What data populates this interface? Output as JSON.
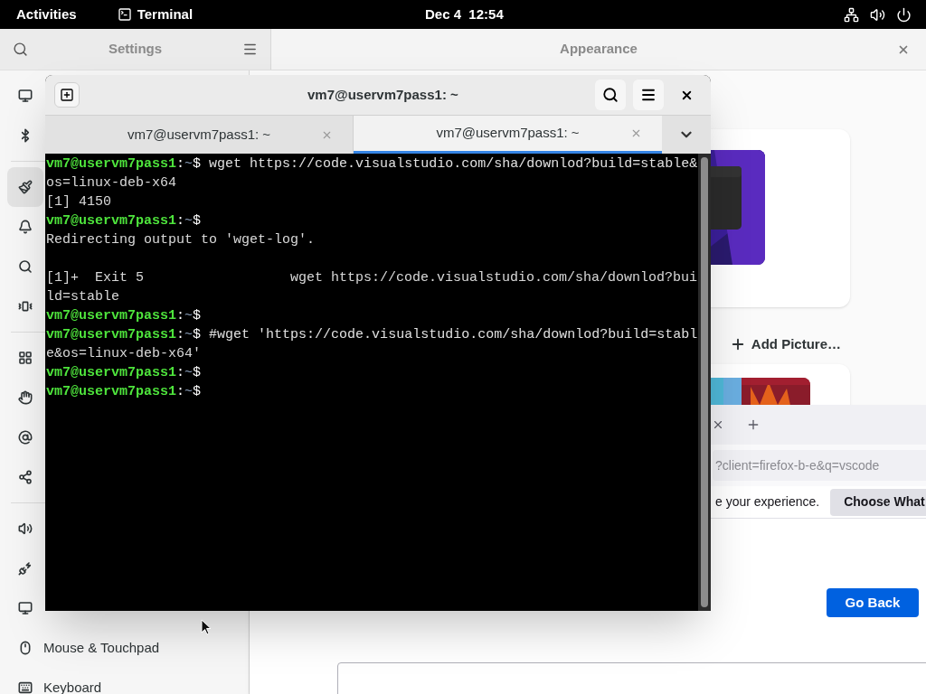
{
  "top_bar": {
    "activities": "Activities",
    "app": "Terminal",
    "clock": "Dec 4  12:54"
  },
  "settings": {
    "title": "Settings",
    "page_title": "Appearance",
    "add_picture": "Add Picture…",
    "sidebar_groups": [
      [
        {
          "selected": false
        },
        {
          "selected": false
        }
      ],
      [
        {
          "selected": true
        },
        {
          "selected": false
        },
        {
          "selected": false
        },
        {
          "selected": false
        }
      ],
      [
        {
          "selected": false
        },
        {
          "selected": false
        },
        {
          "selected": false
        },
        {
          "selected": false
        }
      ],
      [
        {
          "selected": false
        },
        {
          "selected": false
        },
        {
          "selected": false
        },
        {
          "label": "Mouse & Touchpad",
          "selected": false
        },
        {
          "label": "Keyboard",
          "selected": false
        }
      ]
    ]
  },
  "browser": {
    "address": "?client=firefox-b-e&q=vscode",
    "notification": "e your experience.",
    "notification_button": "Choose What",
    "go_back": "Go Back"
  },
  "terminal": {
    "title": "vm7@uservm7pass1: ~",
    "tabs": [
      {
        "label": "vm7@uservm7pass1: ~",
        "selected": false
      },
      {
        "label": "vm7@uservm7pass1: ~",
        "selected": true
      }
    ],
    "lines": [
      {
        "kind": "prompt",
        "user": "vm7@uservm7pass1",
        "separator": ":",
        "path": "~",
        "symbol": "$",
        "command": "wget https://code.visualstudio.com/sha/downlod?build=stable&"
      },
      {
        "kind": "output",
        "text": "os=linux-deb-x64"
      },
      {
        "kind": "output",
        "text": "[1] 4150"
      },
      {
        "kind": "prompt",
        "user": "vm7@uservm7pass1",
        "separator": ":",
        "path": "~",
        "symbol": "$"
      },
      {
        "kind": "output",
        "text": "Redirecting output to 'wget-log'."
      },
      {
        "kind": "blank"
      },
      {
        "kind": "output",
        "text": "[1]+  Exit 5                  wget https://code.visualstudio.com/sha/downlod?bui"
      },
      {
        "kind": "output",
        "text": "ld=stable"
      },
      {
        "kind": "prompt",
        "user": "vm7@uservm7pass1",
        "separator": ":",
        "path": "~",
        "symbol": "$"
      },
      {
        "kind": "prompt",
        "user": "vm7@uservm7pass1",
        "separator": ":",
        "path": "~",
        "symbol": "$",
        "command": "#wget 'https://code.visualstudio.com/sha/downlod?build=stabl"
      },
      {
        "kind": "output",
        "text": "e&os=linux-deb-x64'"
      },
      {
        "kind": "prompt",
        "user": "vm7@uservm7pass1",
        "separator": ":",
        "path": "~",
        "symbol": "$"
      },
      {
        "kind": "prompt",
        "user": "vm7@uservm7pass1",
        "separator": ":",
        "path": "~",
        "symbol": "$"
      }
    ]
  }
}
